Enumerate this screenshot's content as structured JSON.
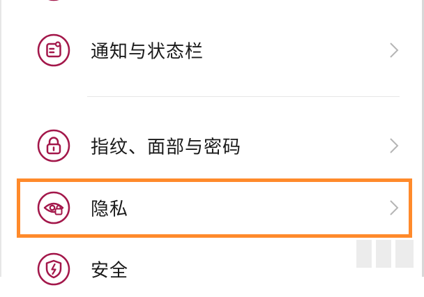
{
  "settings": {
    "items": [
      {
        "label": "通知与状态栏",
        "icon": "notification-bar-icon"
      },
      {
        "label": "指纹、面部与密码",
        "icon": "lock-icon"
      },
      {
        "label": "隐私",
        "icon": "privacy-eye-icon"
      },
      {
        "label": "安全",
        "icon": "security-shield-icon"
      }
    ]
  },
  "colors": {
    "icon_accent": "#a3174a",
    "highlight_border": "#ff8a2b",
    "chevron": "#b5b5b5",
    "divider": "#e6e6e6"
  }
}
